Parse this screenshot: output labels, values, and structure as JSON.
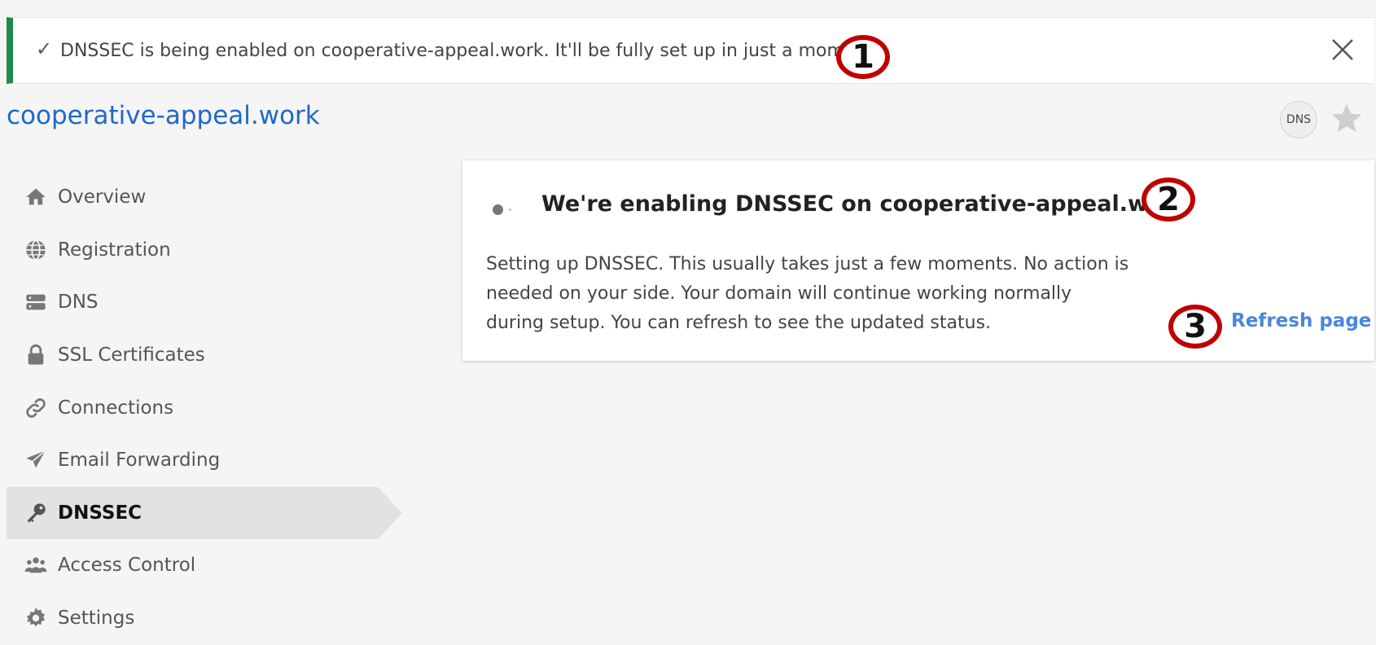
{
  "notice": {
    "check": "✓",
    "message": "DNSSEC is being enabled on cooperative-appeal.work. It'll be fully set up in just a moment.",
    "close_icon": "close-icon"
  },
  "header": {
    "domain": "cooperative-appeal.work",
    "badge": "DNS",
    "star_icon": "star-icon"
  },
  "sidebar": {
    "items": [
      {
        "label": "Overview",
        "icon": "home-icon"
      },
      {
        "label": "Registration",
        "icon": "globe-icon"
      },
      {
        "label": "DNS",
        "icon": "server-icon"
      },
      {
        "label": "SSL Certificates",
        "icon": "lock-icon"
      },
      {
        "label": "Connections",
        "icon": "link-icon"
      },
      {
        "label": "Email Forwarding",
        "icon": "paper-plane-icon"
      },
      {
        "label": "DNSSEC",
        "icon": "key-icon",
        "active": true
      },
      {
        "label": "Access Control",
        "icon": "users-icon"
      },
      {
        "label": "Settings",
        "icon": "gear-icon"
      }
    ]
  },
  "card": {
    "title": "We're enabling DNSSEC on cooperative-appeal.work",
    "description": "Setting up DNSSEC. This usually takes just a few moments. No action is needed on your side. Your domain will continue working normally during setup. You can refresh to see the updated status.",
    "refresh_label": "Refresh page"
  },
  "markers": [
    "1",
    "2",
    "3"
  ],
  "colors": {
    "accent_green": "#1f8a4c",
    "link_blue": "#2068c8",
    "refresh_blue": "#4a86d9",
    "marker_red": "#c00000"
  }
}
